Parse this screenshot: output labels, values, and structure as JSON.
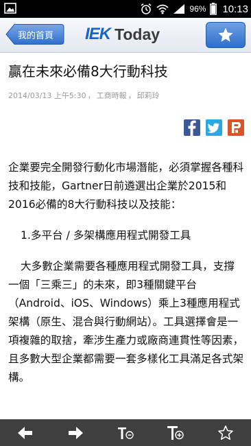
{
  "status_bar": {
    "battery_percent": "96%",
    "time": "10:13"
  },
  "header": {
    "back_label": "我的首頁",
    "logo_part1": "IEK",
    "logo_part2": "Today",
    "favorite_icon": "star-icon"
  },
  "article": {
    "title": "贏在未來必備8大行動科技",
    "date": "2014/03/13 上午5:30",
    "source": "工商時報",
    "author": "邱莉玲",
    "share_icons": [
      "facebook-icon",
      "twitter-icon",
      "plurk-icon"
    ],
    "paragraphs": [
      "企業要完全開發行動化市場潛能，必須掌握各種科技和技能，Gartner日前遴選出企業於2015和2016必備的8大行動科技以及技能：",
      "1.多平台 / 多架構應用程式開發工具",
      "大多數企業需要各種應用程式開發工具，支撐一個「三乘三」的未來，即3種關鍵平台（Android、iOS、Windows）乘上3種應用程式架構（原生、混合與行動網站）。工具選擇會是一項複雜的取捨，牽涉生產力或廠商連貫性等因素，且多數大型企業都需要一套多樣化工具滿足各式架構。"
    ]
  },
  "bottom_bar": {
    "buttons": [
      "back-arrow-icon",
      "forward-arrow-icon",
      "decrease-font-icon",
      "increase-font-icon",
      "favorite-star-icon"
    ]
  },
  "colors": {
    "brand_blue": "#1b63c8",
    "facebook": "#3b5998",
    "twitter": "#29a9e1",
    "plurk": "#d9542b"
  }
}
